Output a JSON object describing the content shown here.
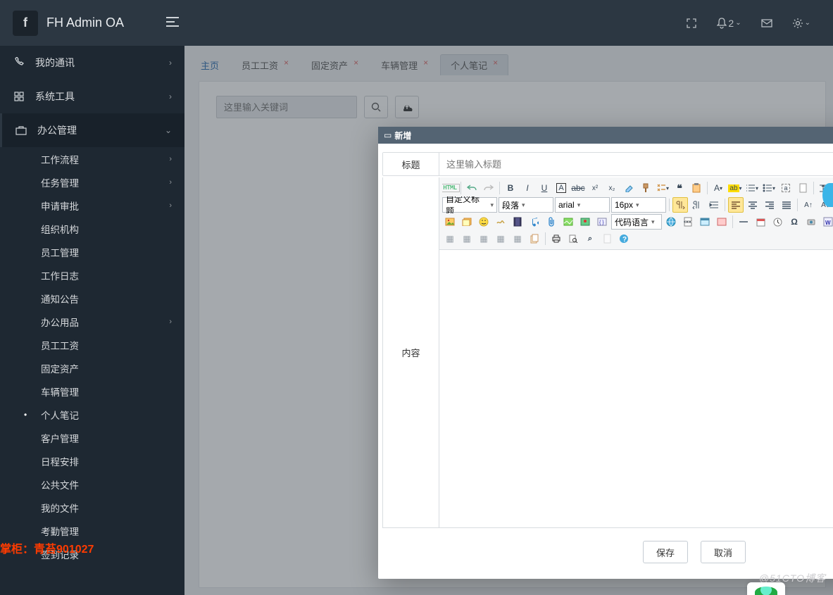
{
  "brand": {
    "badge": "f",
    "title": "FH Admin OA"
  },
  "topbar": {
    "notif_count": "2"
  },
  "sidebar": {
    "top_items": [
      {
        "label": "我的通讯",
        "arrow": true
      },
      {
        "label": "系统工具",
        "arrow": true
      },
      {
        "label": "办公管理",
        "arrow": true,
        "open": true,
        "active": true
      }
    ],
    "sub_items": [
      {
        "label": "工作流程",
        "arrow": true
      },
      {
        "label": "任务管理",
        "arrow": true
      },
      {
        "label": "申请审批",
        "arrow": true
      },
      {
        "label": "组织机构"
      },
      {
        "label": "员工管理"
      },
      {
        "label": "工作日志"
      },
      {
        "label": "通知公告"
      },
      {
        "label": "办公用品",
        "arrow": true
      },
      {
        "label": "员工工资"
      },
      {
        "label": "固定资产"
      },
      {
        "label": "车辆管理"
      },
      {
        "label": "个人笔记",
        "current": true
      },
      {
        "label": "客户管理"
      },
      {
        "label": "日程安排"
      },
      {
        "label": "公共文件"
      },
      {
        "label": "我的文件"
      },
      {
        "label": "考勤管理"
      },
      {
        "label": "签到记录"
      }
    ]
  },
  "tabs": [
    {
      "label": "主页",
      "closable": false
    },
    {
      "label": "员工工资",
      "closable": true
    },
    {
      "label": "固定资产",
      "closable": true
    },
    {
      "label": "车辆管理",
      "closable": true
    },
    {
      "label": "个人笔记",
      "closable": true,
      "active": true
    }
  ],
  "page": {
    "search_placeholder": "这里输入关键词"
  },
  "modal": {
    "title": "新增",
    "label_title": "标题",
    "title_placeholder": "这里输入标题",
    "label_content": "内容",
    "editor": {
      "heading_select": "自定义标题",
      "paragraph_select": "段落",
      "font_select": "arial",
      "size_select": "16px",
      "lang_select": "代码语言"
    },
    "btn_save": "保存",
    "btn_cancel": "取消"
  },
  "watermark_left": "掌柜：青苔901027",
  "watermark_br": "@51CTO博客"
}
